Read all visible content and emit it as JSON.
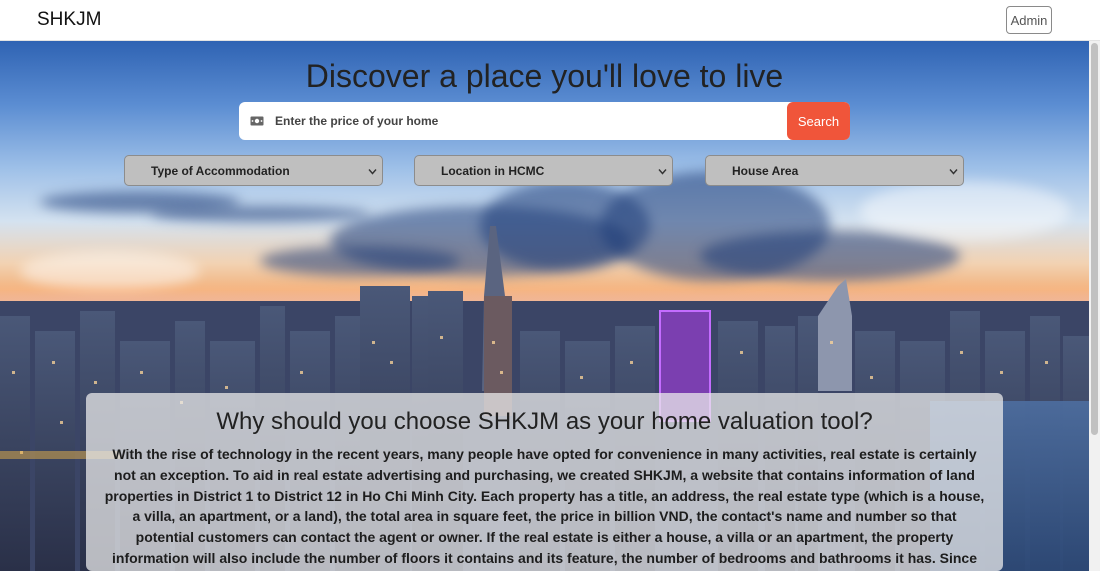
{
  "navbar": {
    "brand": "SHKJM",
    "admin_label": "Admin"
  },
  "hero": {
    "headline": "Discover a place you'll love to live",
    "search": {
      "placeholder": "Enter the price of your home",
      "value": "",
      "icon": "money-icon",
      "button_label": "Search"
    },
    "filters": [
      {
        "label": "Type of Accommodation"
      },
      {
        "label": "Location in HCMC"
      },
      {
        "label": "House Area"
      }
    ]
  },
  "about": {
    "title": "Why should you choose SHKJM as your home valuation tool?",
    "body": "With the rise of technology in the recent years, many people have opted for convenience in many activities, real estate is certainly not an exception. To aid in real estate advertising and purchasing, we created SHKJM, a website that contains information of land properties in District 1 to District 12 in Ho Chi Minh City. Each property has a title, an address, the real estate type (which is a house, a villa, an apartment, or a land), the total area in square feet, the price in billion VND, the contact's name and number so that potential customers can contact the agent or owner. If the real estate is either a house, a villa or an apartment, the property information will also include the number of floors it contains and its feature, the number of bedrooms and bathrooms it has. Since everything can be done"
  },
  "colors": {
    "accent": "#f0553a",
    "select_bg": "#bfbfbf"
  }
}
